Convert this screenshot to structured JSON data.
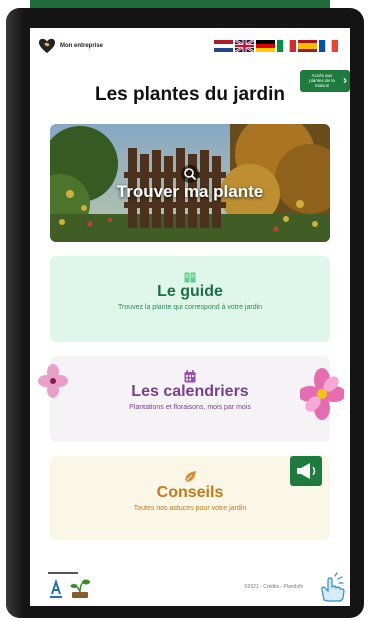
{
  "header": {
    "logo_name": "Mon entreprise",
    "logo_icon": "heart-leaf-logo",
    "languages": [
      "nl",
      "en",
      "de",
      "it",
      "es",
      "fr"
    ],
    "access_button": "Accès aux plantes de la maison"
  },
  "page_title": "Les plantes du jardin",
  "hero": {
    "label": "Trouver ma plante",
    "icon": "search-icon"
  },
  "cards": {
    "guide": {
      "title": "Le guide",
      "subtitle": "Trouvez la plante qui correspond à votre jardin",
      "icon": "book-icon"
    },
    "calendars": {
      "title": "Les calendriers",
      "subtitle": "Plantations et floraisons, mois par mois",
      "icon": "calendar-icon"
    },
    "tips": {
      "title": "Conseils",
      "subtitle": "Toutes nos astuces pour votre jardin",
      "icon": "leaf-icon"
    }
  },
  "footer": {
    "text": "©2021 - Crédits - PlantInfo"
  },
  "colors": {
    "brand_green": "#1f7a3e",
    "guide_bg": "#dff7ea",
    "calendar_bg": "#f6f3f7",
    "tips_bg": "#fbf7e6",
    "calendar_accent": "#7a3f8e",
    "tips_accent": "#c7781a"
  }
}
